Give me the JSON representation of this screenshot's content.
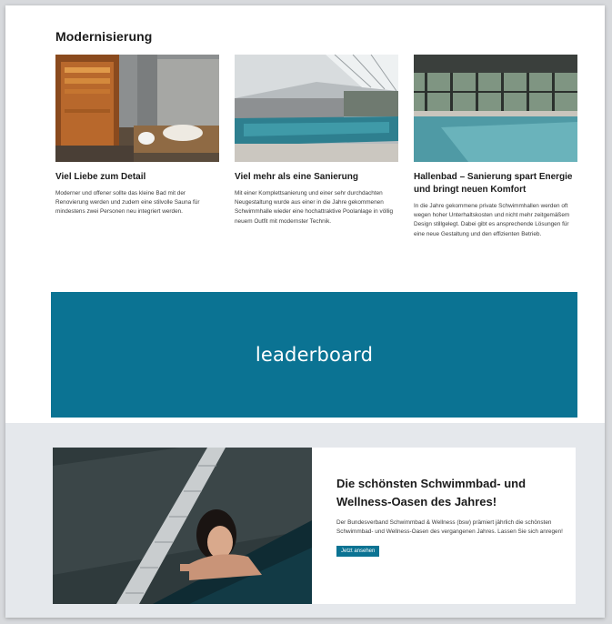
{
  "section": {
    "title": "Modernisierung"
  },
  "cards": [
    {
      "title": "Viel Liebe zum Detail",
      "text": "Moderner und offener sollte das kleine Bad mit der Renovierung werden und zudem eine stilvolle Sauna für mindestens zwei Personen neu integriert werden.",
      "image_icon": "sauna-photo"
    },
    {
      "title": "Viel mehr als eine Sanierung",
      "text": "Mit einer Komplettsanierung und einer sehr durchdachten Neugestaltung wurde aus einer in die Jahre gekommenen Schwimmhalle wieder eine hochattraktive Poolanlage in völlig neuem Outfit mit modernster Technik.",
      "image_icon": "indoor-pool-photo"
    },
    {
      "title": "Hallenbad – Sanierung spart Energie und bringt neuen Komfort",
      "text": "In die Jahre gekommene private Schwimmhallen werden oft wegen hoher Unterhaltskosten und nicht mehr zeitgemäßem Design stillgelegt. Dabei gibt es ansprechende Lösungen für eine neue Gestaltung und den effizienten Betrieb.",
      "image_icon": "hallenbad-photo"
    }
  ],
  "leaderboard": {
    "label": "leaderboard"
  },
  "feature": {
    "title": "Die schönsten Schwimmbad- und Wellness-Oasen des Jahres!",
    "text": "Der Bundesverband Schwimmbad & Wellness (bsw) prämiert jährlich die schönsten Schwimmbad- und Wellness-Oasen des vergangenen Jahres. Lassen Sie sich anregen!",
    "button_label": "Jetzt ansehen",
    "image_icon": "woman-in-pool-photo"
  },
  "colors": {
    "accent": "#0b7393",
    "band": "#e5e8ec"
  }
}
